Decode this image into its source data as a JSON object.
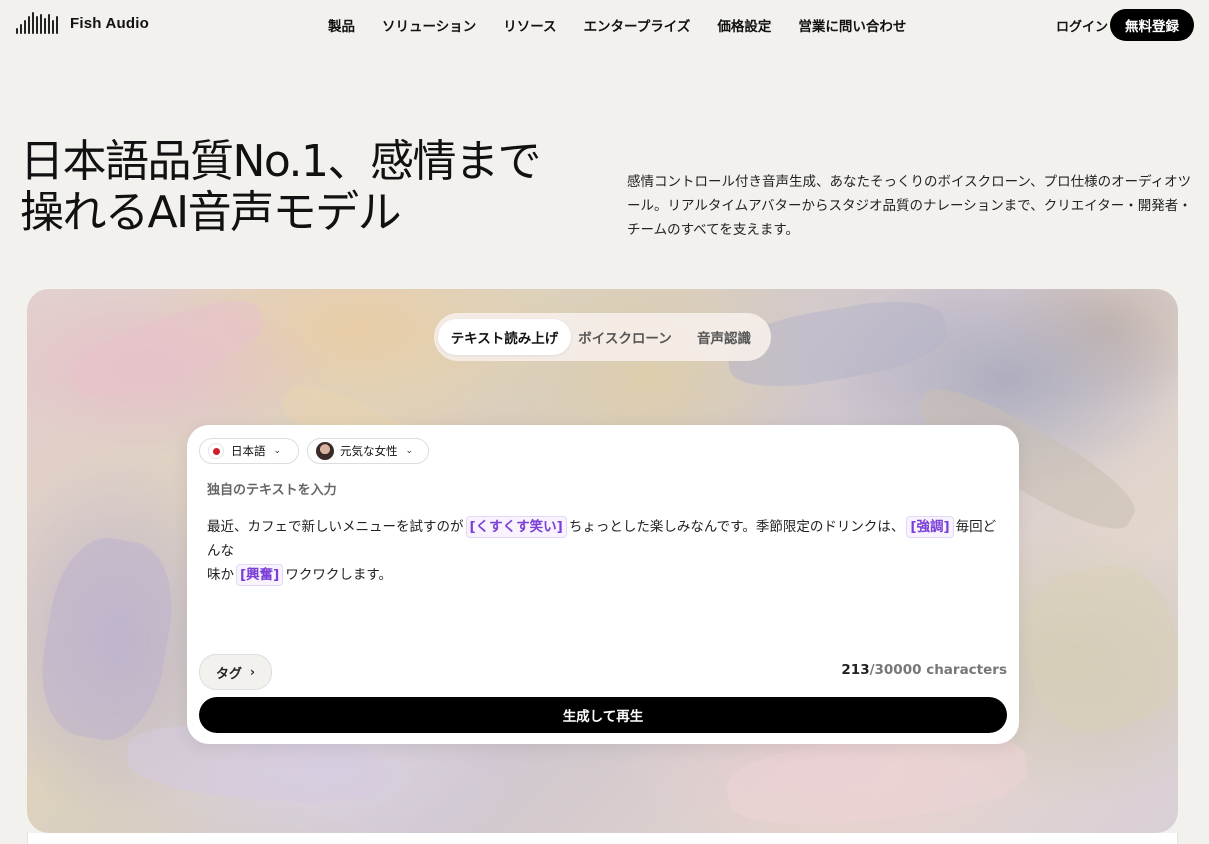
{
  "brand": {
    "name": "Fish Audio"
  },
  "nav": {
    "items": [
      "製品",
      "ソリューション",
      "リソース",
      "エンタープライズ",
      "価格設定",
      "営業に問い合わせ"
    ],
    "login": "ログイン",
    "signup": "無料登録"
  },
  "hero": {
    "title_line1": "日本語品質No.1、感情まで",
    "title_line2": "操れるAI音声モデル",
    "description": "感情コントロール付き音声生成、あなたそっくりのボイスクローン、プロ仕様のオーディオツール。リアルタイムアバターからスタジオ品質のナレーションまで、クリエイター・開発者・チームのすべてを支えます。"
  },
  "tabs": {
    "items": [
      "テキスト読み上げ",
      "ボイスクローン",
      "音声認識"
    ],
    "active_index": 0
  },
  "editor": {
    "language": "日本語",
    "voice": "元気な女性",
    "placeholder": "独自のテキストを入力",
    "text": {
      "seg1": "最近、カフェで新しいメニューを試すのが",
      "tag1": "[くすくす笑い]",
      "seg2": "ちょっとした楽しみなんです。季節限定のドリンクは、",
      "tag2": "[強調]",
      "seg3": "毎回どんな",
      "seg4": "味か",
      "tag3": "[興奮]",
      "seg5": "ワクワクします。"
    },
    "tags_button": "タグ",
    "char_count": "213",
    "char_limit": "/30000 characters",
    "generate_button": "生成して再生"
  },
  "colors": {
    "page_bg": "#f3f1ee",
    "primary": "#000000",
    "tag_accent": "#7a3fd6",
    "flag_red": "#d01c2d"
  }
}
